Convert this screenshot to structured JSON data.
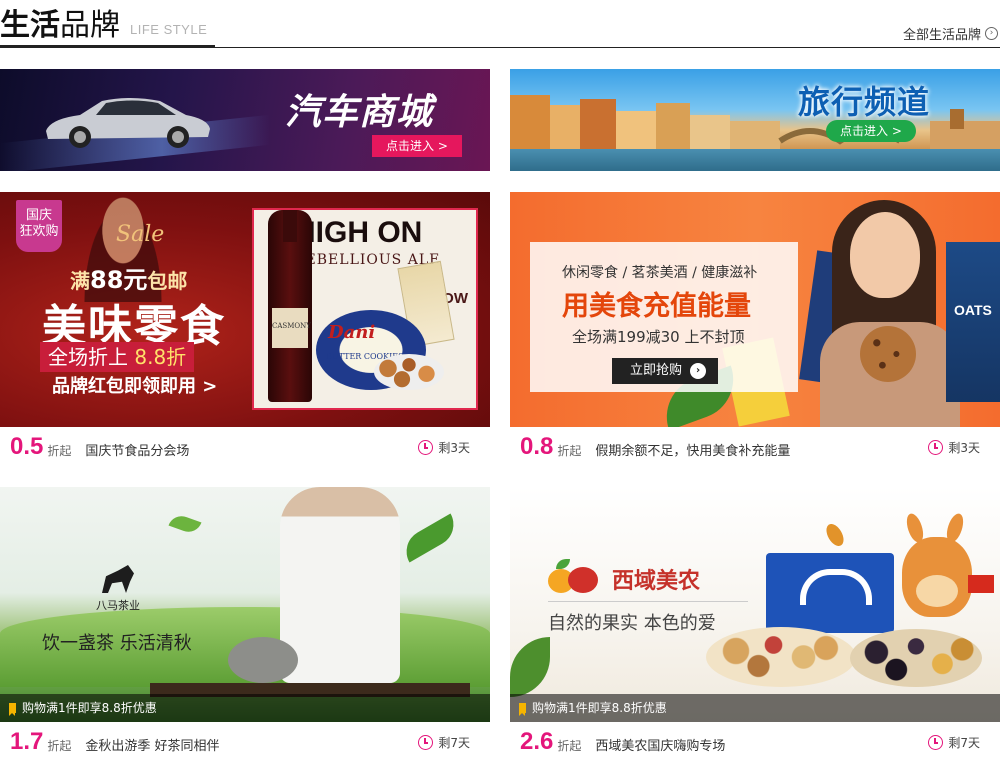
{
  "header": {
    "title_bold": "生活",
    "title_rest": "品牌",
    "subtitle": "LIFE STYLE",
    "all_link": "全部生活品牌"
  },
  "banners": [
    {
      "title": "汽车商城",
      "button": "点击进入 >"
    },
    {
      "title": "旅行频道",
      "button": "点击进入 >"
    }
  ],
  "cards": [
    {
      "discount": "0.5",
      "discount_unit": "折起",
      "name": "国庆节食品分会场",
      "time_left": "剩3天",
      "image_text": {
        "badge": "国庆\n狂欢购",
        "sale": "Sale",
        "line1_prefix": "满",
        "line1_amount": "88元",
        "line1_suffix": "包邮",
        "line2": "美味零食",
        "line3_prefix": "全场折上",
        "line3_value": "8.8折",
        "line4": "品牌红包即领即用 >",
        "panel_title": "HIGH ON",
        "panel_sub": "REBELLIOUS ALE",
        "panel_show": "SHOW",
        "bottle_label": "CASMONY",
        "tin_brand": "Dani",
        "tin_sub": "BUTTER COOKIES"
      }
    },
    {
      "discount": "0.8",
      "discount_unit": "折起",
      "name": "假期余额不足，快用美食补充能量",
      "time_left": "剩3天",
      "image_text": {
        "line1": "休闲零食 / 茗茶美酒 / 健康滋补",
        "line2": "用美食充值能量",
        "line3": "全场满199减30 上不封顶",
        "button": "立即抢购",
        "pack": "OATS"
      }
    },
    {
      "discount": "1.7",
      "discount_unit": "折起",
      "name": "金秋出游季 好茶同相伴",
      "time_left": "剩7天",
      "promo": "购物满1件即享8.8折优惠",
      "image_text": {
        "brand": "八马茶业",
        "slogan": "饮一盏茶 乐活清秋"
      }
    },
    {
      "discount": "2.6",
      "discount_unit": "折起",
      "name": "西域美农国庆嗨购专场",
      "time_left": "剩7天",
      "promo": "购物满1件即享8.8折优惠",
      "image_text": {
        "brand": "西域美农",
        "slogan": "自然的果实 本色的爱"
      }
    }
  ],
  "colors": {
    "accent": "#e4167b",
    "car_button": "#e5175d",
    "travel_button": "#1fa84a"
  }
}
